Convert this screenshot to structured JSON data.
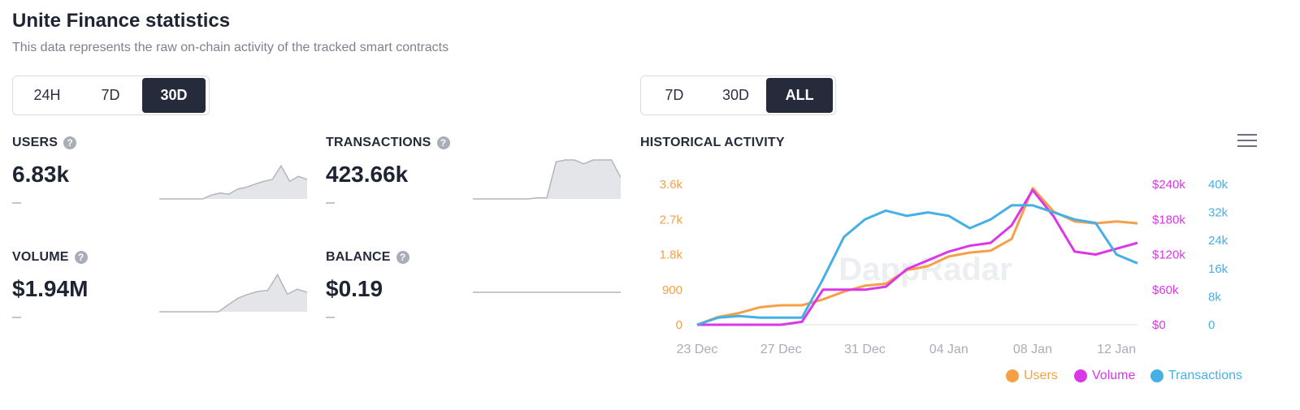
{
  "header": {
    "title": "Unite Finance statistics",
    "subtitle": "This data represents the raw on-chain activity of the tracked smart contracts"
  },
  "period_left": {
    "options": [
      "24H",
      "7D",
      "30D"
    ],
    "selected": "30D"
  },
  "period_right": {
    "options": [
      "7D",
      "30D",
      "ALL"
    ],
    "selected": "ALL"
  },
  "stats": {
    "users": {
      "label": "USERS",
      "value": "6.83k",
      "change": "—"
    },
    "transactions": {
      "label": "TRANSACTIONS",
      "value": "423.66k",
      "change": "—"
    },
    "volume": {
      "label": "VOLUME",
      "value": "$1.94M",
      "change": "—"
    },
    "balance": {
      "label": "BALANCE",
      "value": "$0.19",
      "change": "—"
    }
  },
  "sparklines": {
    "users": [
      0,
      0,
      0,
      0,
      0,
      0,
      0.1,
      0.15,
      0.12,
      0.25,
      0.3,
      0.38,
      0.45,
      0.5,
      0.85,
      0.45,
      0.58,
      0.5
    ],
    "transactions": [
      0,
      0,
      0,
      0,
      0,
      0,
      0,
      0.03,
      0.03,
      0.95,
      1,
      1,
      0.9,
      1,
      1,
      1,
      0.55
    ],
    "volume": [
      0,
      0,
      0,
      0,
      0,
      0,
      0,
      0.18,
      0.35,
      0.45,
      0.52,
      0.55,
      0.95,
      0.45,
      0.58,
      0.5
    ],
    "balance": [
      0.5,
      0.5,
      0.5,
      0.5,
      0.5,
      0.5
    ]
  },
  "historical": {
    "label": "HISTORICAL ACTIVITY",
    "menu_icon": "hamburger-menu-icon"
  },
  "chart_data": {
    "type": "line",
    "x": [
      "23 Dec",
      "24 Dec",
      "25 Dec",
      "26 Dec",
      "27 Dec",
      "28 Dec",
      "29 Dec",
      "30 Dec",
      "31 Dec",
      "01 Jan",
      "02 Jan",
      "03 Jan",
      "04 Jan",
      "05 Jan",
      "06 Jan",
      "07 Jan",
      "08 Jan",
      "09 Jan",
      "10 Jan",
      "11 Jan",
      "12 Jan",
      "13 Jan"
    ],
    "x_ticks": [
      "23 Dec",
      "27 Dec",
      "31 Dec",
      "04 Jan",
      "08 Jan",
      "12 Jan"
    ],
    "series": [
      {
        "name": "Users",
        "color": "#f5a047",
        "axis": "left",
        "values": [
          0,
          200,
          300,
          450,
          500,
          500,
          650,
          850,
          1000,
          1050,
          1400,
          1500,
          1750,
          1850,
          1900,
          2200,
          3500,
          2900,
          2650,
          2600,
          2650,
          2600
        ]
      },
      {
        "name": "Volume",
        "color": "#d937e8",
        "axis": "middle",
        "values": [
          0,
          0,
          0,
          0,
          0,
          5000,
          60000,
          60000,
          60000,
          65000,
          95000,
          110000,
          125000,
          135000,
          140000,
          170000,
          230000,
          185000,
          125000,
          120000,
          130000,
          140000
        ]
      },
      {
        "name": "Transactions",
        "color": "#45b0e6",
        "axis": "right",
        "values": [
          0,
          2000,
          2500,
          2000,
          2000,
          2000,
          13000,
          25000,
          30000,
          32500,
          31000,
          32000,
          31000,
          27500,
          30000,
          34000,
          34000,
          32000,
          30000,
          29000,
          20000,
          17500
        ]
      }
    ],
    "axes": {
      "left": {
        "ticks": [
          "0",
          "900",
          "1.8k",
          "2.7k",
          "3.6k"
        ],
        "range": [
          0,
          3600
        ],
        "color": "#f5a047"
      },
      "middle": {
        "ticks": [
          "$0",
          "$60k",
          "$120k",
          "$180k",
          "$240k"
        ],
        "range": [
          0,
          240000
        ],
        "color": "#d937e8"
      },
      "right": {
        "ticks": [
          "0",
          "8k",
          "16k",
          "24k",
          "32k",
          "40k"
        ],
        "range": [
          0,
          40000
        ],
        "color": "#45b0e6"
      }
    },
    "watermark": "DappRadar",
    "legend": [
      "Users",
      "Volume",
      "Transactions"
    ],
    "legend_position": "bottom-right"
  }
}
